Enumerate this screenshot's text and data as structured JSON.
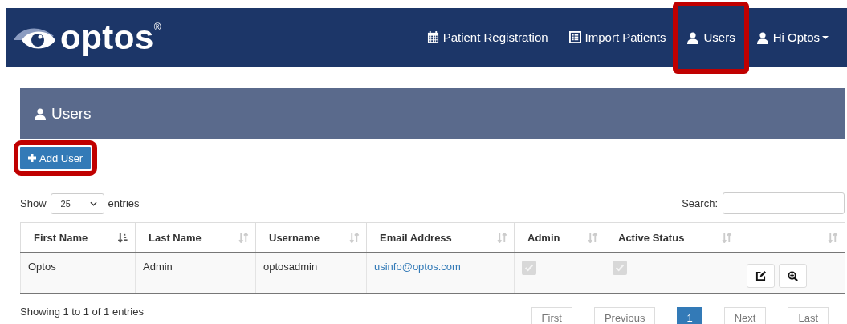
{
  "navbar": {
    "brand": "optos$^{®}$",
    "items": [
      {
        "label": "Patient Registration",
        "selected": false,
        "highlighted": false,
        "dropdown": false
      },
      {
        "label": "Import Patients",
        "selected": false,
        "highlighted": false,
        "dropdown": false
      },
      {
        "label": "Users",
        "selected": true,
        "highlighted": true,
        "dropdown": false
      },
      {
        "label": "Hi Optos",
        "selected": false,
        "highlighted": false,
        "dropdown": true
      }
    ]
  },
  "panel": {
    "title": "Users"
  },
  "add_button": {
    "label": "Add User",
    "highlighted": true
  },
  "length_control": {
    "before": "Show",
    "value": "25",
    "after": "entries"
  },
  "search": {
    "label": "Search:"
  },
  "table": {
    "columns": [
      {
        "label": "First Name",
        "sorted": true
      },
      {
        "label": "Last Name",
        "sorted": false
      },
      {
        "label": "Username",
        "sorted": false
      },
      {
        "label": "Email Address",
        "sorted": false
      },
      {
        "label": "Admin",
        "sorted": false
      },
      {
        "label": "Active Status",
        "sorted": false
      },
      {
        "sorted": false
      }
    ],
    "rows": [
      {
        "first_name": "Optos",
        "last_name": "Admin",
        "username": "optosadmin",
        "email": "usinfo@optos.com",
        "admin": {
          "checked": true,
          "disabled": true
        },
        "active": {
          "checked": true,
          "disabled": true
        }
      }
    ]
  },
  "info": "Showing 1 to 1 of 1 entries",
  "pagination": [
    {
      "label": "First",
      "selected": false
    },
    {
      "label": "Previous",
      "selected": false
    },
    {
      "label": "1",
      "selected": true
    },
    {
      "label": "Next",
      "selected": false
    },
    {
      "label": "Last",
      "selected": false
    }
  ]
}
